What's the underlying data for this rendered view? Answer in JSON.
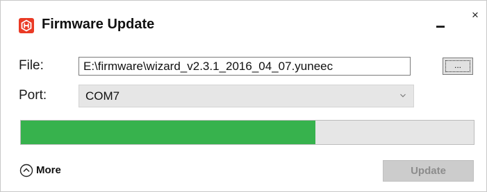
{
  "window": {
    "title": "Firmware Update",
    "minimize_glyph": "",
    "close_glyph": "×",
    "logo_icon": "yuneec-hex-logo-icon",
    "accent_color": "#ea3a25"
  },
  "form": {
    "file_label": "File:",
    "file_value": "E:\\firmware\\wizard_v2.3.1_2016_04_07.yuneec",
    "browse_label": "...",
    "port_label": "Port:",
    "port_value": "COM7",
    "port_dropdown_icon": "chevron-down-icon"
  },
  "progress": {
    "percent": 65,
    "fill_color": "#37b24d",
    "track_color": "#e6e6e6"
  },
  "footer": {
    "more_label": "More",
    "more_icon": "chevron-up-circle-icon",
    "update_label": "Update",
    "update_enabled": false
  }
}
